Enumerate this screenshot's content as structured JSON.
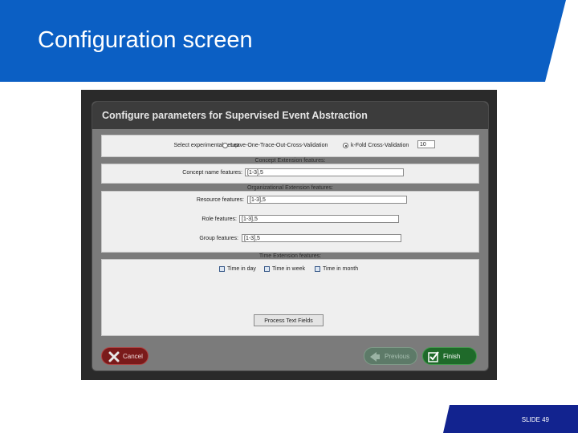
{
  "slide": {
    "title": "Configuration screen",
    "number": "SLIDE 49",
    "colors": {
      "title_bar": "#0b5fc4",
      "footer_bar": "#12238f"
    }
  },
  "dialog": {
    "title": "Configure parameters for Supervised Event Abstraction",
    "experimental_setup": {
      "label": "Select experimental setup:",
      "options": [
        {
          "label": "Leave-One-Trace-Out-Cross-Validation",
          "selected": false
        },
        {
          "label": "k-Fold Cross-Validation",
          "selected": true
        }
      ],
      "k_value": "10"
    },
    "concept_section": {
      "header": "Concept Extension features:",
      "concept_name_label": "Concept name features:",
      "concept_name_value": "[1-3],5"
    },
    "organizational_section": {
      "header": "Organizational Extension features:",
      "resource_label": "Resource features:",
      "resource_value": "[1-3],5",
      "role_label": "Role features:",
      "role_value": "[1-3],5",
      "group_label": "Group features:",
      "group_value": "[1-3],5"
    },
    "time_section": {
      "header": "Time Extension features:",
      "options": [
        {
          "label": "Time in day",
          "checked": false
        },
        {
          "label": "Time in week",
          "checked": false
        },
        {
          "label": "Time in month",
          "checked": false
        }
      ]
    },
    "process_button": "Process Text Fields",
    "buttons": {
      "cancel": "Cancel",
      "previous": "Previous",
      "finish": "Finish"
    },
    "icons": {
      "cancel": "x-icon",
      "previous": "arrow-left-icon",
      "finish": "checkmark-icon"
    },
    "colors": {
      "cancel": "#7a1a1a",
      "previous": "#5d7a68",
      "finish": "#1f6a2a",
      "header": "#3c3c3c"
    }
  }
}
